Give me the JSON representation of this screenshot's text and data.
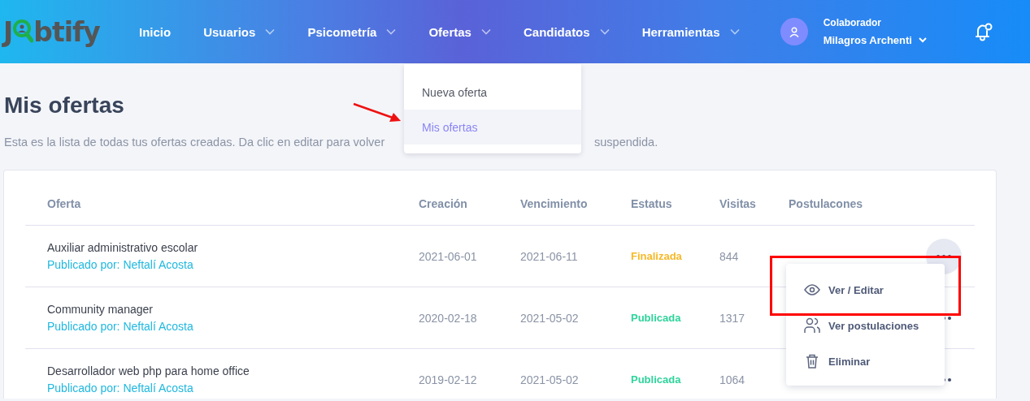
{
  "header": {
    "logo": [
      "J",
      "btify"
    ],
    "nav": [
      {
        "label": "Inicio",
        "dropdown": false
      },
      {
        "label": "Usuarios",
        "dropdown": true
      },
      {
        "label": "Psicometría",
        "dropdown": true
      },
      {
        "label": "Ofertas",
        "dropdown": true
      },
      {
        "label": "Candidatos",
        "dropdown": true
      },
      {
        "label": "Herramientas",
        "dropdown": true
      }
    ],
    "user": {
      "role": "Colaborador",
      "name": "Milagros Archenti"
    }
  },
  "nav_menu": {
    "items": [
      {
        "label": "Nueva oferta",
        "selected": false
      },
      {
        "label": "Mis ofertas",
        "selected": true
      }
    ]
  },
  "page": {
    "title": "Mis ofertas",
    "subtitle_parts": [
      "Esta es la lista de todas tus ofertas creadas. Da clic en editar para volver",
      "suspendida."
    ]
  },
  "table": {
    "columns": [
      "Oferta",
      "Creación",
      "Vencimiento",
      "Estatus",
      "Visitas",
      "Postulacones"
    ],
    "rows": [
      {
        "title": "Auxiliar administrativo escolar",
        "publisher": "Publicado por: Neftalí Acosta",
        "created": "2021-06-01",
        "expires": "2021-06-11",
        "status": {
          "label": "Finalizada",
          "kind": "finished"
        },
        "visits": "844",
        "menu_open": true
      },
      {
        "title": "Community manager",
        "publisher": "Publicado por: Neftalí Acosta",
        "created": "2020-02-18",
        "expires": "2021-05-02",
        "status": {
          "label": "Publicada",
          "kind": "published"
        },
        "visits": "1317",
        "menu_open": false
      },
      {
        "title": "Desarrollador web php para home office",
        "publisher": "Publicado por: Neftalí Acosta",
        "created": "2019-02-12",
        "expires": "2021-05-02",
        "status": {
          "label": "Publicada",
          "kind": "published"
        },
        "visits": "1064",
        "menu_open": false
      }
    ]
  },
  "row_menu": {
    "items": [
      {
        "label": "Ver / Editar",
        "kind": "view"
      },
      {
        "label": "Ver postulaciones",
        "kind": "applicants"
      },
      {
        "label": "Eliminar",
        "kind": "delete"
      }
    ]
  }
}
